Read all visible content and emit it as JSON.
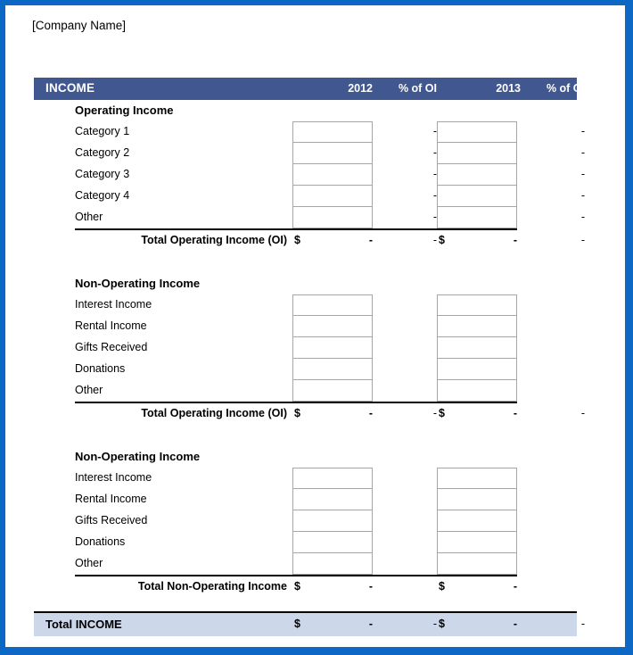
{
  "company_name": "[Company Name]",
  "table": {
    "header": {
      "title": "INCOME",
      "col_year_1": "2012",
      "col_pct_1": "% of OI",
      "col_year_2": "2013",
      "col_pct_2": "% of OI"
    },
    "sections": [
      {
        "title": "Operating Income",
        "items": [
          {
            "label": "Category 1",
            "value_1": "",
            "pct_1": "-",
            "value_2": "",
            "pct_2": "-"
          },
          {
            "label": "Category 2",
            "value_1": "",
            "pct_1": "-",
            "value_2": "",
            "pct_2": "-"
          },
          {
            "label": "Category 3",
            "value_1": "",
            "pct_1": "-",
            "value_2": "",
            "pct_2": "-"
          },
          {
            "label": "Category 4",
            "value_1": "",
            "pct_1": "-",
            "value_2": "",
            "pct_2": "-"
          },
          {
            "label": "Other",
            "value_1": "",
            "pct_1": "-",
            "value_2": "",
            "pct_2": "-"
          }
        ],
        "total": {
          "label": "Total Operating Income (OI)",
          "currency_1": "$",
          "amount_1": "-",
          "pct_1": "-",
          "currency_2": "$",
          "amount_2": "-",
          "pct_2": "-"
        }
      },
      {
        "title": "Non-Operating Income",
        "items": [
          {
            "label": "Interest Income",
            "value_1": "",
            "pct_1": "",
            "value_2": "",
            "pct_2": ""
          },
          {
            "label": "Rental Income",
            "value_1": "",
            "pct_1": "",
            "value_2": "",
            "pct_2": ""
          },
          {
            "label": "Gifts Received",
            "value_1": "",
            "pct_1": "",
            "value_2": "",
            "pct_2": ""
          },
          {
            "label": "Donations",
            "value_1": "",
            "pct_1": "",
            "value_2": "",
            "pct_2": ""
          },
          {
            "label": "Other",
            "value_1": "",
            "pct_1": "",
            "value_2": "",
            "pct_2": ""
          }
        ],
        "total": {
          "label": "Total Operating Income (OI)",
          "currency_1": "$",
          "amount_1": "-",
          "pct_1": "-",
          "currency_2": "$",
          "amount_2": "-",
          "pct_2": "-"
        }
      },
      {
        "title": "Non-Operating Income",
        "items": [
          {
            "label": "Interest Income",
            "value_1": "",
            "pct_1": "",
            "value_2": "",
            "pct_2": ""
          },
          {
            "label": "Rental Income",
            "value_1": "",
            "pct_1": "",
            "value_2": "",
            "pct_2": ""
          },
          {
            "label": "Gifts Received",
            "value_1": "",
            "pct_1": "",
            "value_2": "",
            "pct_2": ""
          },
          {
            "label": "Donations",
            "value_1": "",
            "pct_1": "",
            "value_2": "",
            "pct_2": ""
          },
          {
            "label": "Other",
            "value_1": "",
            "pct_1": "",
            "value_2": "",
            "pct_2": ""
          }
        ],
        "total": {
          "label": "Total Non-Operating Income",
          "currency_1": "$",
          "amount_1": "-",
          "pct_1": "",
          "currency_2": "$",
          "amount_2": "-",
          "pct_2": ""
        }
      }
    ],
    "grand_total": {
      "label": "Total INCOME",
      "currency_1": "$",
      "amount_1": "-",
      "pct_1": "-",
      "currency_2": "$",
      "amount_2": "-",
      "pct_2": "-"
    }
  },
  "colors": {
    "header_blue": "#40588f",
    "grand_total_band": "#ccd7ea",
    "page_border": "#0c68c4",
    "box_border": "#a6a6a6"
  }
}
